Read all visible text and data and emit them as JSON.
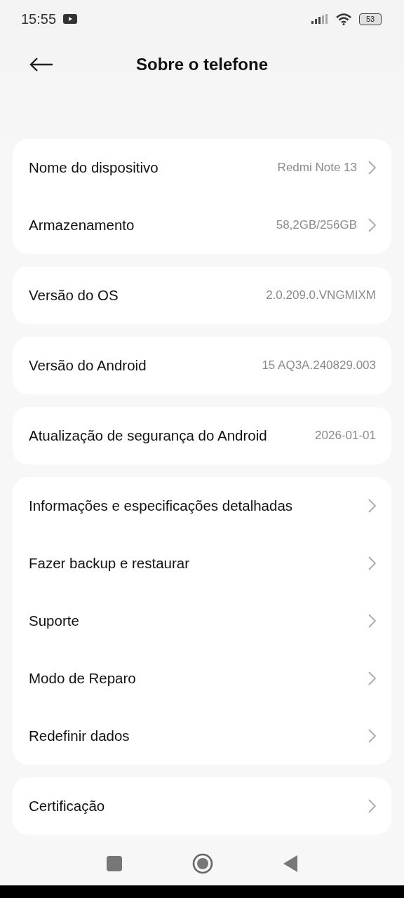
{
  "status_bar": {
    "time": "15:55",
    "battery": "53"
  },
  "header": {
    "title": "Sobre o telefone"
  },
  "groups": [
    {
      "rows": [
        {
          "label": "Nome do dispositivo",
          "value": "Redmi Note 13",
          "chevron": true
        },
        {
          "label": "Armazenamento",
          "value": "58,2GB/256GB",
          "chevron": true
        }
      ]
    },
    {
      "rows": [
        {
          "label": "Versão do OS",
          "value": "2.0.209.0.VNGMIXM",
          "chevron": false
        }
      ]
    },
    {
      "rows": [
        {
          "label": "Versão do Android",
          "value": "15 AQ3A.240829.003",
          "chevron": false
        }
      ]
    },
    {
      "rows": [
        {
          "label": "Atualização de segurança do Android",
          "value": "2026-01-01",
          "chevron": false
        }
      ]
    },
    {
      "rows": [
        {
          "label": "Informações e especificações detalhadas",
          "chevron": true
        },
        {
          "label": "Fazer backup e restaurar",
          "chevron": true
        },
        {
          "label": "Suporte",
          "chevron": true
        },
        {
          "label": "Modo de Reparo",
          "chevron": true
        },
        {
          "label": "Redefinir dados",
          "chevron": true
        }
      ]
    },
    {
      "rows": [
        {
          "label": "Certificação",
          "chevron": true
        }
      ]
    }
  ]
}
